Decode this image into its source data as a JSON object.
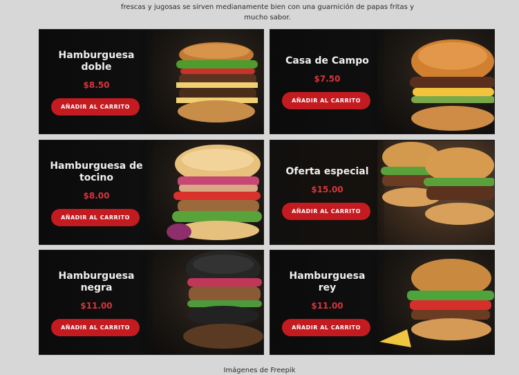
{
  "intro_text_line1": "frescas y jugosas se sirven medianamente bien con una guarnición de papas fritas y",
  "intro_text_line2": "mucho sabor.",
  "button_label": "AÑADIR AL CARRITO",
  "credit": "Imágenes de Freepik",
  "colors": {
    "price": "#d9343a",
    "button": "#c41b21",
    "background": "#d7d7d7"
  },
  "cards": [
    {
      "title_line1": "Hamburguesa",
      "title_line2": "doble",
      "price": "$8.50"
    },
    {
      "title_line1": "Casa de Campo",
      "title_line2": "",
      "price": "$7.50"
    },
    {
      "title_line1": "Hamburguesa de",
      "title_line2": "tocino",
      "price": "$8.00"
    },
    {
      "title_line1": "Oferta especial",
      "title_line2": "",
      "price": "$15.00"
    },
    {
      "title_line1": "Hamburguesa",
      "title_line2": "negra",
      "price": "$11.00"
    },
    {
      "title_line1": "Hamburguesa",
      "title_line2": "rey",
      "price": "$11.00"
    }
  ]
}
